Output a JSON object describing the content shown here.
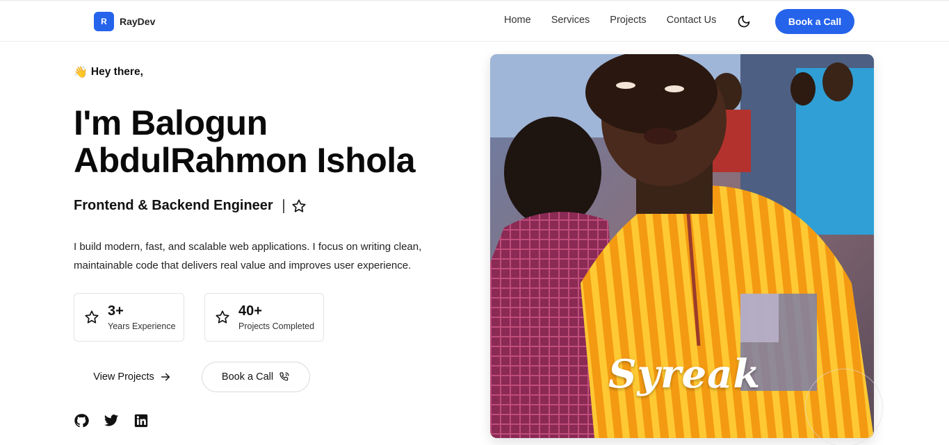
{
  "nav": {
    "logo_letter": "R",
    "brand": "RayDev",
    "links": [
      "Home",
      "Services",
      "Projects",
      "Contact Us"
    ],
    "theme_icon": "moon-icon",
    "cta": "Book a Call",
    "accent": "#2563eb"
  },
  "hero": {
    "greeting_emoji": "👋",
    "greeting": "Hey there,",
    "name_line1": "I'm Balogun",
    "name_line2": "AbdulRahmon Ishola",
    "role": "Frontend & Backend Engineer",
    "description": "I build modern, fast, and scalable web applications. I focus on writing clean, maintainable code that delivers real value and improves user experience.",
    "stats": [
      {
        "value": "3+",
        "label": "Years Experience",
        "icon": "star-icon"
      },
      {
        "value": "40+",
        "label": "Projects Completed",
        "icon": "star-icon"
      }
    ],
    "view_projects": "View Projects",
    "book_call": "Book a Call",
    "socials": [
      "github-icon",
      "twitter-icon",
      "linkedin-icon"
    ]
  },
  "photo": {
    "watermark": "Syreak",
    "alt_colors": {
      "shirt": "#f7a51a",
      "stripe": "#ffcf3a"
    }
  }
}
